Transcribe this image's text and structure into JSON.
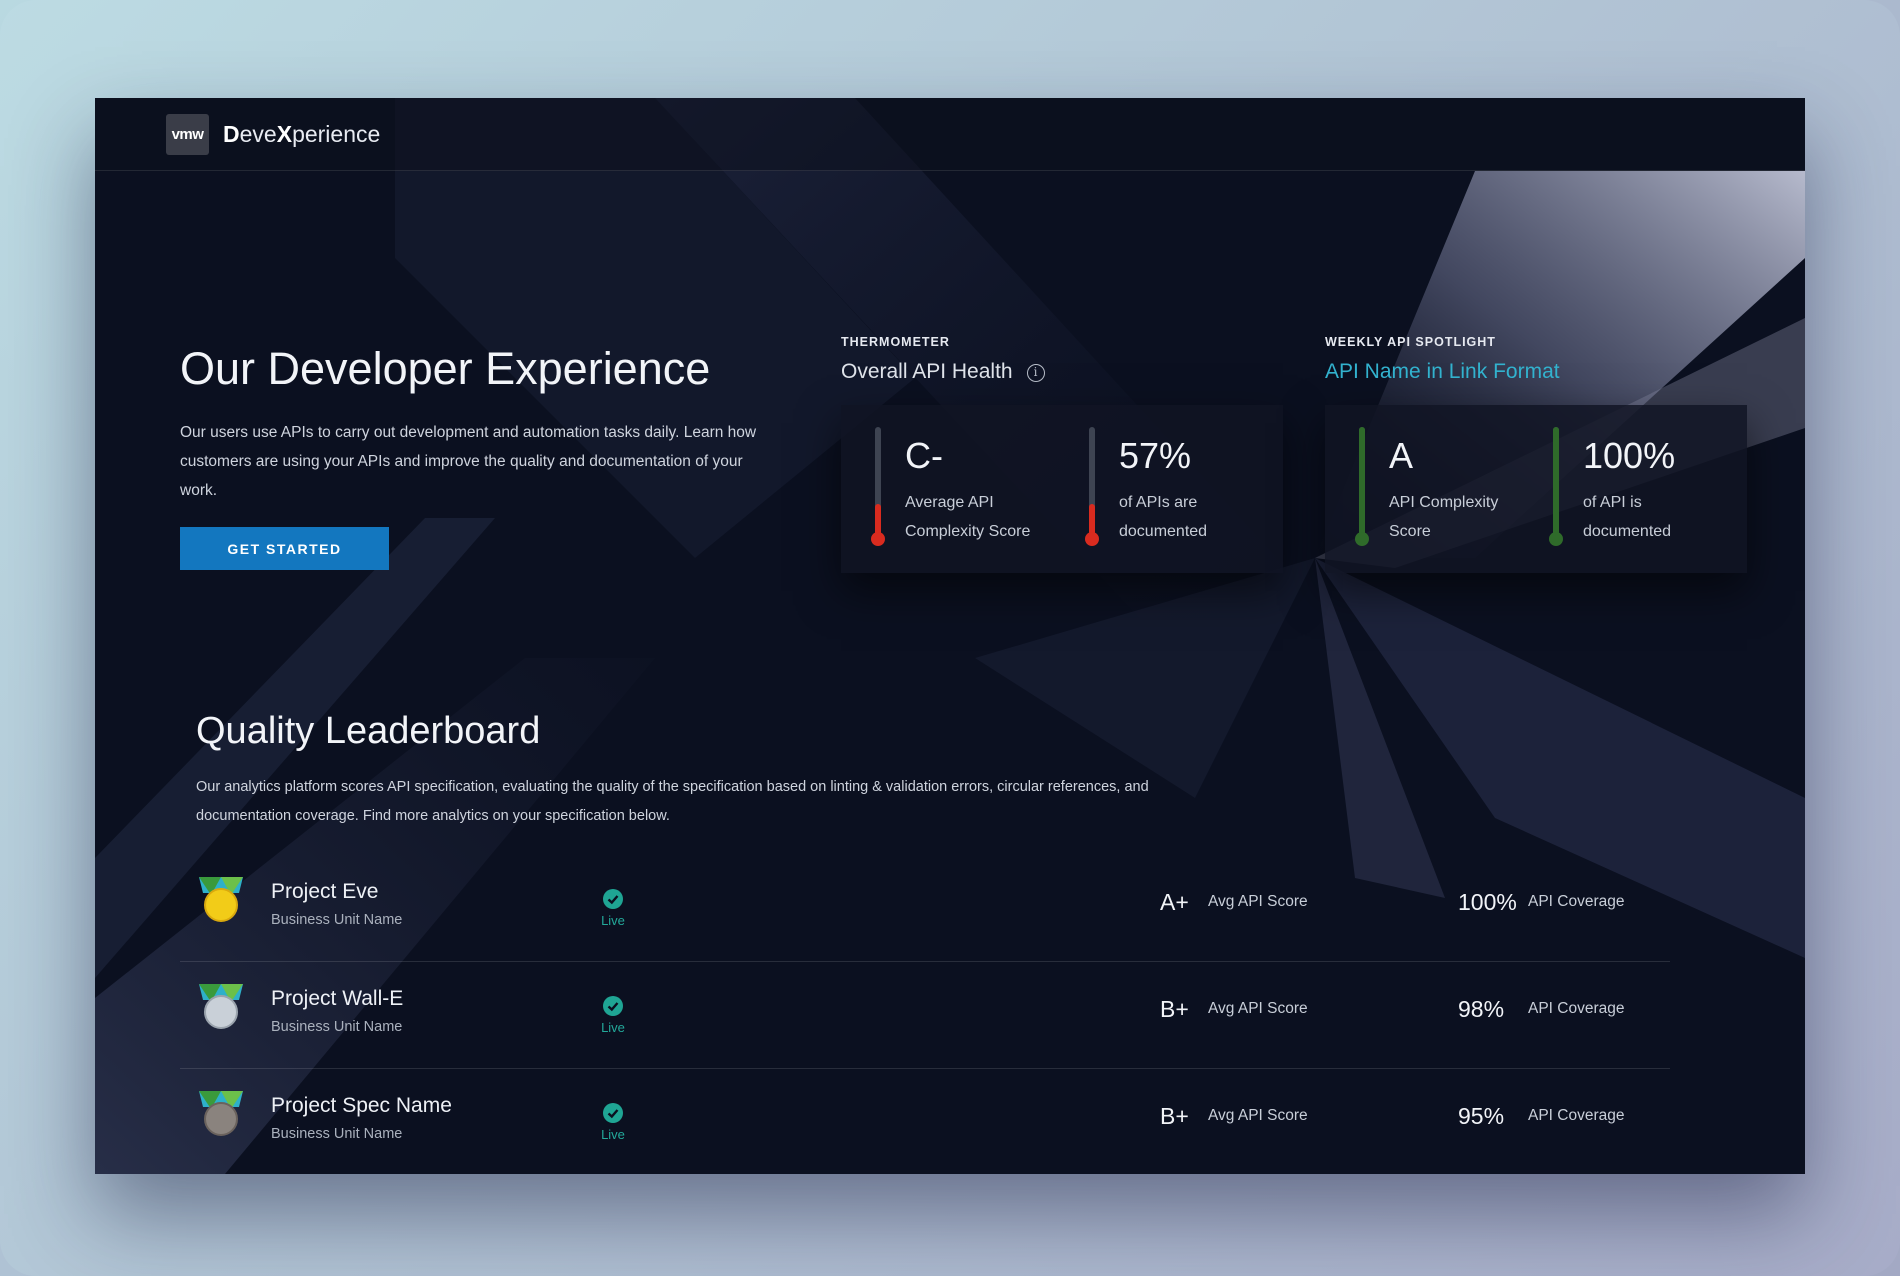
{
  "header": {
    "logo_text": "vmw",
    "app_title_prefix": "D",
    "app_title_mid": "eve",
    "app_title_x": "X",
    "app_title_suffix": "perience"
  },
  "hero": {
    "title": "Our Developer Experience",
    "description": "Our users use APIs to carry out development and automation tasks daily. Learn how customers are using your APIs and improve the quality and documentation of your work.",
    "cta_label": "GET STARTED"
  },
  "thermometer": {
    "eyebrow": "THERMOMETER",
    "title": "Overall API Health",
    "info_glyph": "i",
    "metrics": [
      {
        "value": "C-",
        "label": "Average API Complexity Score",
        "level": 0.3,
        "color": "#d92b1f"
      },
      {
        "value": "57%",
        "label": "of APIs are documented",
        "level": 0.3,
        "color": "#d92b1f"
      }
    ]
  },
  "spotlight": {
    "eyebrow": "WEEKLY API SPOTLIGHT",
    "link_text": "API Name in Link Format",
    "metrics": [
      {
        "value": "A",
        "label": "API Complexity Score",
        "level": 1.0,
        "color": "#2f6b2a"
      },
      {
        "value": "100%",
        "label": "of API is documented",
        "level": 1.0,
        "color": "#2f6b2a"
      }
    ]
  },
  "leaderboard": {
    "title": "Quality Leaderboard",
    "description": "Our analytics platform scores API specification, evaluating the quality of the specification based on linting & validation errors, circular references, and documentation coverage. Find more analytics on your specification below.",
    "rows": [
      {
        "name": "Project Eve",
        "unit": "Business Unit Name",
        "status": "Live",
        "grade": "A+",
        "grade_label": "Avg API Score",
        "coverage": "100%",
        "coverage_label": "API Coverage",
        "medal": "gold"
      },
      {
        "name": "Project Wall-E",
        "unit": "Business Unit Name",
        "status": "Live",
        "grade": "B+",
        "grade_label": "Avg API Score",
        "coverage": "98%",
        "coverage_label": "API Coverage",
        "medal": "silver"
      },
      {
        "name": "Project Spec Name",
        "unit": "Business Unit Name",
        "status": "Live",
        "grade": "B+",
        "grade_label": "Avg API Score",
        "coverage": "95%",
        "coverage_label": "API Coverage",
        "medal": "bronze"
      }
    ]
  },
  "colors": {
    "accent_blue": "#1377bf",
    "link_teal": "#33b3cf",
    "live_green": "#23a99a",
    "background": "#0b1020"
  }
}
